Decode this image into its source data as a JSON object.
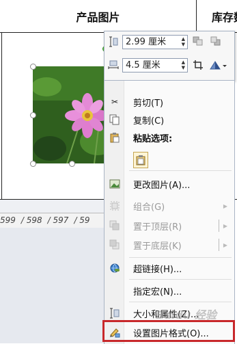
{
  "sheet": {
    "column_headers": [
      "产品图片",
      "库存数"
    ],
    "ruler_numbers": [
      "599",
      "598",
      "597",
      "59"
    ]
  },
  "size_toolbar": {
    "height_value": "2.99 厘米",
    "width_value": "4.5 厘米",
    "icons": [
      "height-icon",
      "width-icon",
      "bring-forward-icon",
      "send-backward-icon",
      "crop-icon",
      "rotate-icon"
    ]
  },
  "context_menu": {
    "items": [
      {
        "label": "剪切(T)",
        "icon": "scissors-icon",
        "enabled": true
      },
      {
        "label": "复制(C)",
        "icon": "copy-icon",
        "enabled": true
      },
      {
        "label": "粘贴选项:",
        "icon": "paste-icon",
        "enabled": true,
        "bold": true
      },
      {
        "label": "更改图片(A)...",
        "icon": "change-picture-icon",
        "enabled": true
      },
      {
        "label": "组合(G)",
        "icon": "group-icon",
        "enabled": false,
        "submenu": true
      },
      {
        "label": "置于顶层(R)",
        "icon": "bring-to-front-icon",
        "enabled": false,
        "submenu": true
      },
      {
        "label": "置于底层(K)",
        "icon": "send-to-back-icon",
        "enabled": false,
        "submenu": true
      },
      {
        "label": "超链接(H)...",
        "icon": "hyperlink-icon",
        "enabled": true
      },
      {
        "label": "指定宏(N)...",
        "icon": "",
        "enabled": true
      },
      {
        "label": "大小和属性(Z)...",
        "icon": "size-properties-icon",
        "enabled": true
      },
      {
        "label": "设置图片格式(O)...",
        "icon": "format-picture-icon",
        "enabled": true,
        "highlighted": true
      }
    ]
  },
  "watermark": "Baidu 经验",
  "colors": {
    "highlight_border": "#c8282b",
    "selection_handle": "#5cc44a"
  }
}
